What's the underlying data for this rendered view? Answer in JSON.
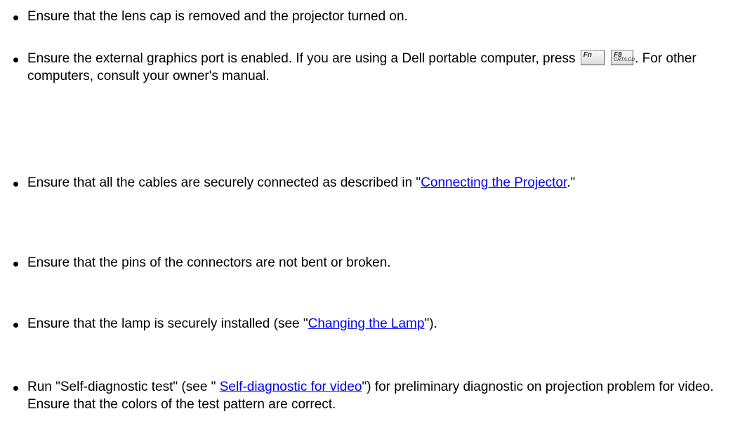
{
  "items": [
    {
      "text": "Ensure that the lens cap is removed and the projector turned on."
    },
    {
      "text_before": "Ensure the external graphics port is enabled. If you are using a Dell portable computer, press ",
      "key1": "Fn",
      "key2_top": "F8",
      "key2_bottom": "CRT/LCD",
      "text_after": ". For other computers, consult your owner's manual."
    },
    {
      "text_before": "Ensure that all the cables are securely connected as described in \"",
      "link": "Connecting the Projector",
      "text_after": ".\""
    },
    {
      "text": "Ensure that the pins of the connectors are not bent or broken."
    },
    {
      "text_before": "Ensure that the lamp is securely installed (see \"",
      "link": "Changing the Lamp",
      "text_after": "\")."
    },
    {
      "text_before": "Run \"Self-diagnostic test\" (see \" ",
      "link": "Self-diagnostic for video",
      "text_after": "\") for preliminary diagnostic on projection problem for video. Ensure that the colors of the test pattern are correct."
    }
  ]
}
